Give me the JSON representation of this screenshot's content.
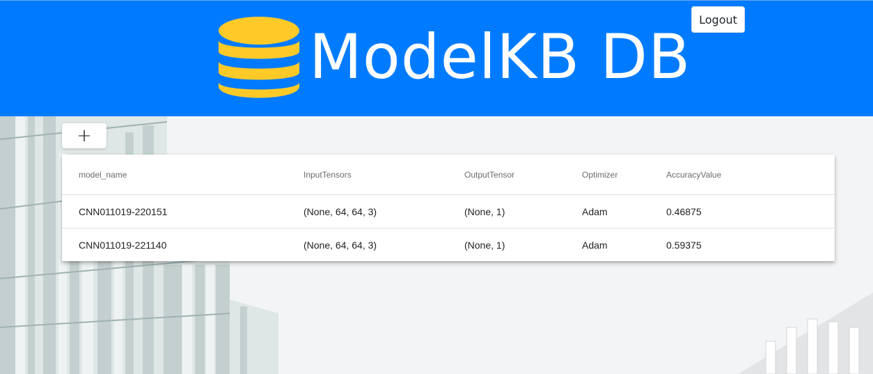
{
  "header": {
    "brand_title": "ModelKB DB",
    "logout_label": "Logout",
    "bg_color": "#007bff",
    "logo_icon": "database-icon",
    "logo_color": "#ffca28"
  },
  "toolbar": {
    "add_label": "+"
  },
  "table": {
    "columns": [
      "model_name",
      "InputTensors",
      "OutputTensor",
      "Optimizer",
      "AccuracyValue"
    ],
    "rows": [
      [
        "CNN011019-220151",
        "(None, 64, 64, 3)",
        "(None, 1)",
        "Adam",
        "0.46875"
      ],
      [
        "CNN011019-221140",
        "(None, 64, 64, 3)",
        "(None, 1)",
        "Adam",
        "0.59375"
      ]
    ]
  }
}
